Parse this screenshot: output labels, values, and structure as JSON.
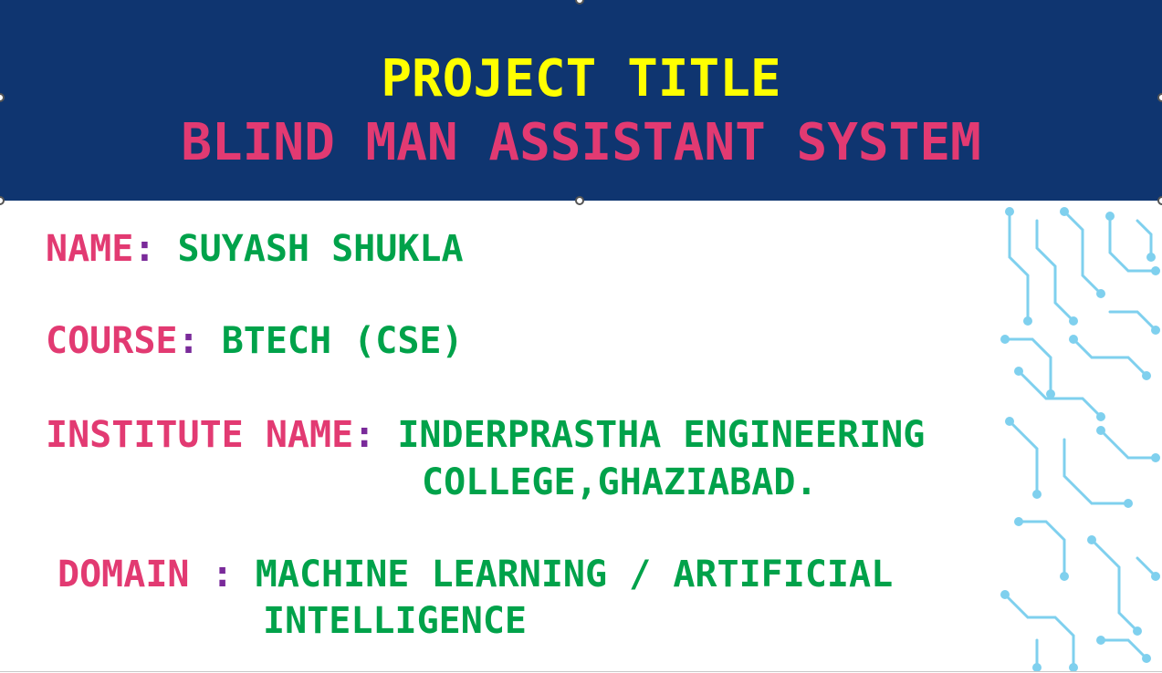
{
  "slide": {
    "heading": "PROJECT TITLE",
    "title": "BLIND MAN ASSISTANT SYSTEM"
  },
  "details": {
    "name": {
      "label": "NAME",
      "sep": ":",
      "value": "SUYASH SHUKLA"
    },
    "course": {
      "label": "COURSE",
      "sep": ":",
      "value": "BTECH (CSE)"
    },
    "institute": {
      "label": "INSTITUTE NAME",
      "sep": ":",
      "value_line1": "INDERPRASTHA ENGINEERING",
      "value_line2": "COLLEGE,GHAZIABAD."
    },
    "domain": {
      "label": "DOMAIN",
      "sep": ":",
      "value_line1": "MACHINE LEARNING / ARTIFICIAL",
      "value_line2": "INTELLIGENCE"
    }
  },
  "colors": {
    "header_bg": "#0f3570",
    "heading": "#ffff00",
    "title": "#e23a72",
    "label": "#e23a72",
    "value": "#00a24a",
    "separator": "#7a2a9a",
    "circuit": "#7fd0ee"
  },
  "decoration": {
    "icon": "circuit-board-pattern"
  }
}
